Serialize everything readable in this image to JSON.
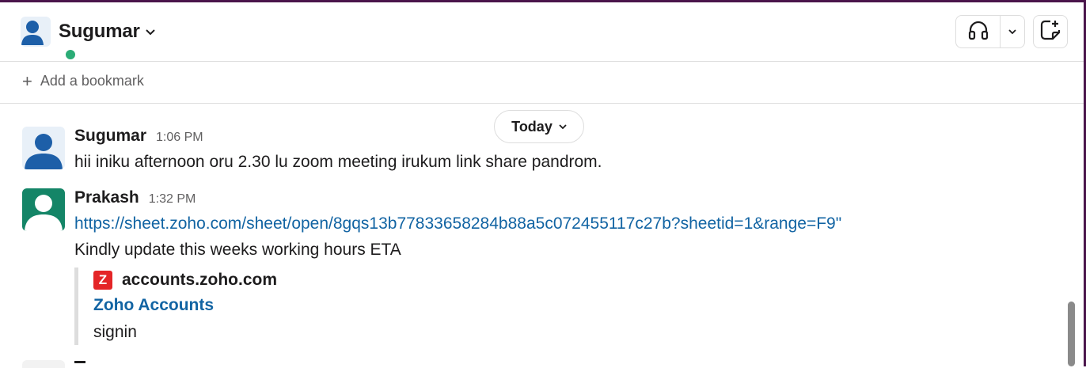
{
  "header": {
    "channel_name": "Sugumar",
    "chevron_icon": "chevron-down-icon",
    "huddle_icon": "headphones-icon",
    "huddle_menu_icon": "chevron-down-icon",
    "canvas_icon": "canvas-icon"
  },
  "bookmarks": {
    "add_label": "Add a bookmark",
    "add_icon": "+"
  },
  "divider": {
    "label": "Today",
    "icon": "chevron-down-icon"
  },
  "messages": [
    {
      "sender": "Sugumar",
      "time": "1:06 PM",
      "text": "hii iniku afternoon oru 2.30 lu zoom meeting irukum link share pandrom.",
      "avatar_color": "#1d5fa8"
    },
    {
      "sender": "Prakash",
      "time": "1:32 PM",
      "link": "https://sheet.zoho.com/sheet/open/8gqs13b77833658284b88a5c072455117c27b?sheetid=1&range=F9",
      "link_suffix": "\"",
      "text": "Kindly update this weeks working hours ETA",
      "avatar_color": "#148567",
      "unfurl": {
        "logo_letter": "Z",
        "site": "accounts.zoho.com",
        "title": "Zoho Accounts",
        "description": "signin"
      }
    }
  ],
  "colors": {
    "accent_link": "#1264a3",
    "presence": "#2bac76",
    "frame": "#4a154b"
  }
}
